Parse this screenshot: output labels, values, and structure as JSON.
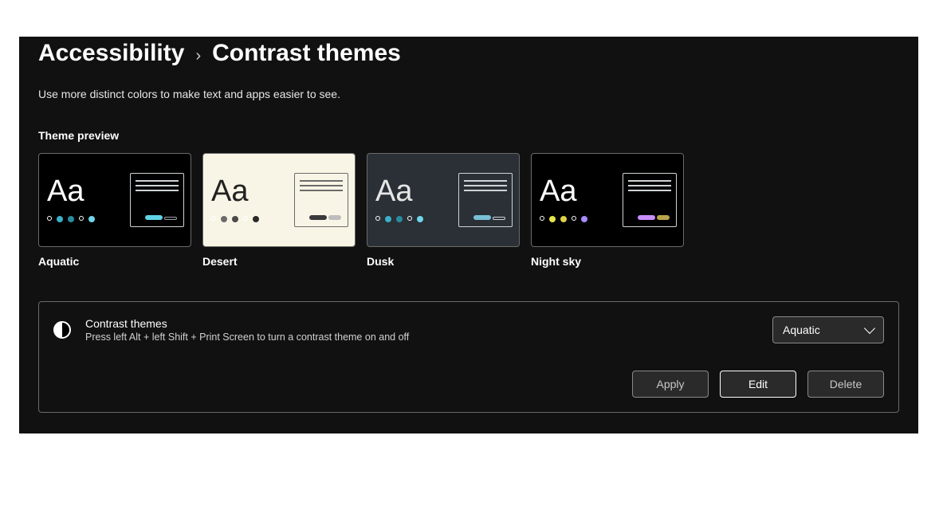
{
  "breadcrumb": {
    "parent": "Accessibility",
    "separator": "›",
    "current": "Contrast themes"
  },
  "subtitle": "Use more distinct colors to make text and apps easier to see.",
  "preview_section_label": "Theme preview",
  "themes": [
    {
      "name": "Aquatic",
      "class": "th-aquatic",
      "aa_text": "Aa",
      "dots": [
        "#ffffff00",
        "#3ab0c9",
        "#2a8ba0",
        "#ffffff00",
        "#6fd6e8"
      ],
      "hollow": [
        true,
        false,
        false,
        true,
        false
      ]
    },
    {
      "name": "Desert",
      "class": "th-desert",
      "aa_text": "Aa",
      "dots": [
        "#22222200",
        "#6b6b6b",
        "#4a4a4a",
        "#22222200",
        "#2a2a2a"
      ],
      "hollow": [
        true,
        false,
        false,
        true,
        false
      ]
    },
    {
      "name": "Dusk",
      "class": "th-dusk",
      "aa_text": "Aa",
      "dots": [
        "#e6e6e600",
        "#3ab0c9",
        "#2a8ba0",
        "#e6e6e600",
        "#6fd6e8"
      ],
      "hollow": [
        true,
        false,
        false,
        true,
        false
      ]
    },
    {
      "name": "Night sky",
      "class": "th-night",
      "aa_text": "Aa",
      "dots": [
        "#ffffff00",
        "#e6e64a",
        "#e0d14a",
        "#ffffff00",
        "#a88cff"
      ],
      "hollow": [
        true,
        false,
        false,
        true,
        false
      ]
    }
  ],
  "settings": {
    "title": "Contrast themes",
    "subtitle": "Press left Alt + left Shift + Print Screen to turn a contrast theme on and off",
    "selected": "Aquatic",
    "buttons": {
      "apply": "Apply",
      "edit": "Edit",
      "delete": "Delete"
    }
  }
}
